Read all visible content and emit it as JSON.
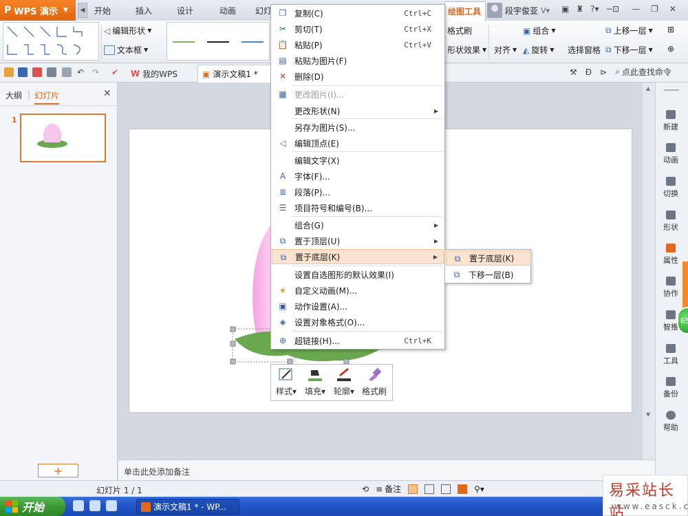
{
  "app": {
    "name": "WPS 演示"
  },
  "tabs": [
    "开始",
    "插入",
    "设计",
    "动画",
    "幻灯"
  ],
  "active_tab": "绘图工具",
  "user": {
    "name": "段宇俊亚"
  },
  "ribbon": {
    "edit_shape": "编辑形状",
    "text_box": "文本框",
    "format_painter": "格式刷",
    "shape_effects": "形状效果",
    "align": "对齐",
    "group": "组合",
    "rotate": "旋转",
    "selection_pane": "选择窗格",
    "bring_forward": "上移一层",
    "send_backward": "下移一层",
    "line_colors": [
      "#77b36b",
      "#222222",
      "#4a86c9"
    ]
  },
  "doc_tabs": {
    "mywps": "我的WPS",
    "doc": "演示文稿1 *"
  },
  "find_command": "点此查找命令",
  "left_pane": {
    "outline": "大纲",
    "slides": "幻灯片",
    "slide_number": "1",
    "add": "+"
  },
  "notes_placeholder": "单击此处添加备注",
  "status": {
    "slide_counter": "幻灯片 1 / 1",
    "notes": "备注"
  },
  "sidebar": [
    "新建",
    "动画",
    "切换",
    "形状",
    "属性",
    "协作",
    "智推",
    "工具",
    "备份",
    "帮助"
  ],
  "badge": "65",
  "context_menu": [
    {
      "label": "复制(C)",
      "shortcut": "Ctrl+C",
      "icon": "copy-icon"
    },
    {
      "label": "剪切(T)",
      "shortcut": "Ctrl+X",
      "icon": "cut-icon"
    },
    {
      "label": "粘贴(P)",
      "shortcut": "Ctrl+V",
      "icon": "paste-icon"
    },
    {
      "label": "粘贴为图片(F)",
      "icon": "paste-image-icon"
    },
    {
      "label": "删除(D)",
      "icon": "delete-icon"
    },
    {
      "label": "更改图片(I)...",
      "disabled": true,
      "icon": "change-image-icon"
    },
    {
      "label": "更改形状(N)",
      "submenu": true
    },
    {
      "label": "另存为图片(S)..."
    },
    {
      "label": "编辑顶点(E)",
      "icon": "edit-points-icon"
    },
    {
      "label": "编辑文字(X)"
    },
    {
      "label": "字体(F)...",
      "icon": "font-icon"
    },
    {
      "label": "段落(P)...",
      "icon": "paragraph-icon"
    },
    {
      "label": "项目符号和编号(B)...",
      "icon": "bullets-icon"
    },
    {
      "label": "组合(G)",
      "submenu": true
    },
    {
      "label": "置于顶层(U)",
      "submenu": true,
      "icon": "bring-to-front-icon"
    },
    {
      "label": "置于底层(K)",
      "submenu": true,
      "highlighted": true,
      "icon": "send-to-back-icon"
    },
    {
      "label": "设置自选图形的默认效果(I)"
    },
    {
      "label": "自定义动画(M)...",
      "icon": "custom-animation-icon"
    },
    {
      "label": "动作设置(A)...",
      "icon": "action-settings-icon"
    },
    {
      "label": "设置对象格式(O)...",
      "icon": "format-object-icon"
    },
    {
      "label": "超链接(H)...",
      "shortcut": "Ctrl+K",
      "icon": "hyperlink-icon"
    }
  ],
  "submenu": [
    {
      "label": "置于底层(K)",
      "highlighted": true
    },
    {
      "label": "下移一层(B)"
    }
  ],
  "mini_toolbar": [
    "样式",
    "填充",
    "轮廓",
    "格式刷"
  ],
  "taskbar": {
    "start": "开始",
    "task": "演示文稿1 * - WP..."
  },
  "watermark": {
    "title": "易采站长站",
    "sub": "www.easck.com"
  }
}
